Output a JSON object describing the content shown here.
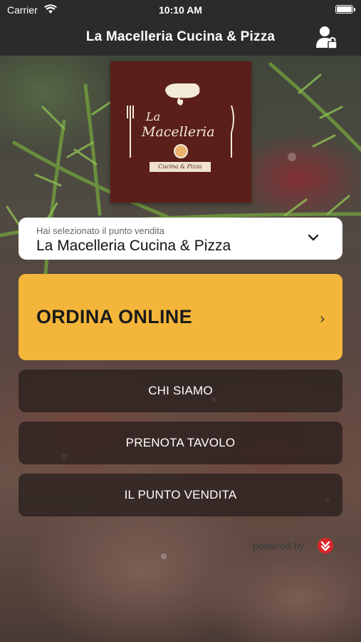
{
  "status_bar": {
    "carrier": "Carrier",
    "time": "10:10 AM"
  },
  "nav": {
    "title": "La Macelleria Cucina & Pizza",
    "account_icon": "user-lock-icon"
  },
  "logo": {
    "line1": "La",
    "line2": "Macelleria",
    "ribbon": "Cucina & Pizza"
  },
  "store": {
    "caption": "Hai selezionato il punto vendita",
    "selected": "La Macelleria Cucina & Pizza"
  },
  "order_button": {
    "label": "ORDINA ONLINE",
    "chevron": "›"
  },
  "menu": {
    "chi_siamo": "CHI SIAMO",
    "prenota": "PRENOTA TAVOLO",
    "punto_vendita": "IL PUNTO VENDITA"
  },
  "footer": {
    "powered_by": "powered by"
  },
  "colors": {
    "bar": "#2b2b2b",
    "accent": "#f4b63a",
    "logo_bg": "#5a1f18",
    "brand_red": "#d9262b"
  }
}
